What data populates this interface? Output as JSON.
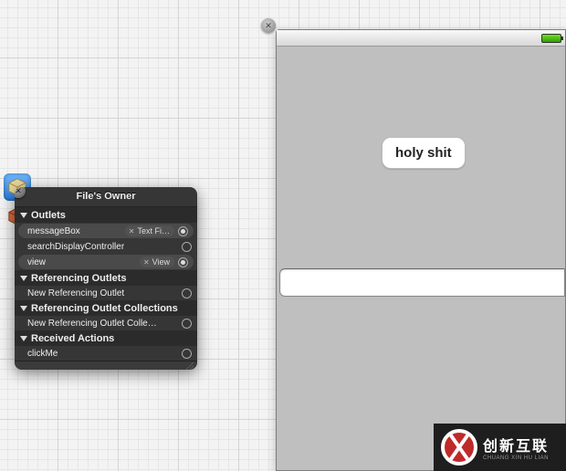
{
  "panel": {
    "title": "File's Owner",
    "sections": {
      "outlets": {
        "header": "Outlets",
        "rows": [
          {
            "name": "messageBox",
            "chip": "Text Fi…",
            "connected": true,
            "selected": true
          },
          {
            "name": "searchDisplayController",
            "chip": null,
            "connected": false,
            "selected": false
          },
          {
            "name": "view",
            "chip": "View",
            "connected": true,
            "selected": true
          }
        ]
      },
      "refOutlets": {
        "header": "Referencing Outlets",
        "rows": [
          {
            "name": "New Referencing Outlet",
            "connected": false
          }
        ]
      },
      "refCollections": {
        "header": "Referencing Outlet Collections",
        "rows": [
          {
            "name": "New Referencing Outlet Colle…",
            "connected": false
          }
        ]
      },
      "actions": {
        "header": "Received Actions",
        "rows": [
          {
            "name": "clickMe",
            "connected": false
          }
        ]
      }
    }
  },
  "device": {
    "button_label": "holy shit",
    "text_field_value": ""
  },
  "watermark": {
    "cn": "创新互联",
    "en": "CHUANG XIN HU LIAN"
  }
}
